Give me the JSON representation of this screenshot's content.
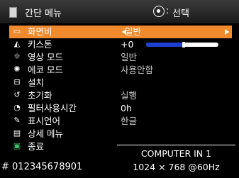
{
  "header": {
    "title": "간단 메뉴",
    "ok_colon": ":",
    "select_label": "선택"
  },
  "menu": {
    "items": [
      {
        "label": "화면비",
        "icon": "aspect-icon",
        "glyph": "▭"
      },
      {
        "label": "키스톤",
        "icon": "keystone-icon",
        "glyph": "◭"
      },
      {
        "label": "영상 모드",
        "icon": "picture-mode-icon",
        "glyph": "☼"
      },
      {
        "label": "에코 모드",
        "icon": "eco-mode-icon",
        "glyph": "✺"
      },
      {
        "label": "설치",
        "icon": "installation-icon",
        "glyph": "⊟"
      },
      {
        "label": "초기화",
        "icon": "reset-icon",
        "glyph": "↺"
      },
      {
        "label": "필터사용시간",
        "icon": "filter-time-icon",
        "glyph": "◔"
      },
      {
        "label": "표시언어",
        "icon": "language-icon",
        "glyph": "✎"
      },
      {
        "label": "상세 메뉴",
        "icon": "advanced-menu-icon",
        "glyph": "▤"
      },
      {
        "label": "종료",
        "icon": "exit-icon",
        "glyph": "▣"
      }
    ]
  },
  "values": {
    "aspect": "일반",
    "keystone": "+0",
    "keystone_level": 0.5,
    "picture_mode": "일반",
    "eco_mode": "사용안함",
    "reset": "실행",
    "filter_time": "0h",
    "language": "한글"
  },
  "input_info": {
    "source": "COMPUTER IN 1",
    "resolution": "1024 × 768 @60Hz"
  },
  "footer": {
    "id": "# 012345678901"
  },
  "colors": {
    "highlight": "#f18a2c",
    "slider_fill": "#1f3fd4",
    "background": "#000000"
  }
}
